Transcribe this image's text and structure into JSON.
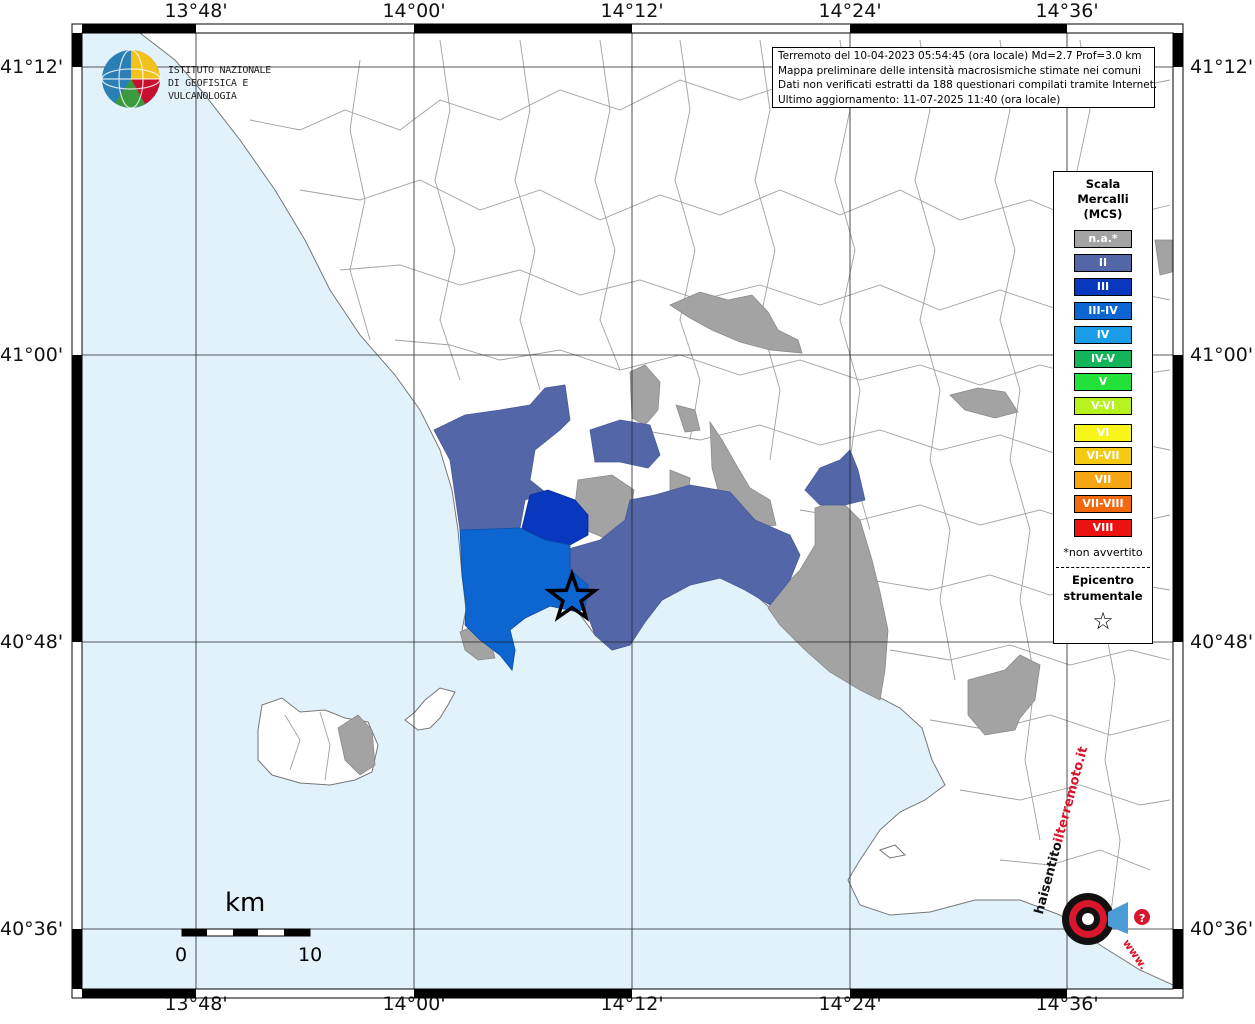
{
  "map": {
    "lon_ticks": [
      "13°48'",
      "14°00'",
      "14°12'",
      "14°24'",
      "14°36'"
    ],
    "lat_ticks": [
      "41°12'",
      "41°00'",
      "40°48'",
      "40°36'"
    ],
    "colors": {
      "sea": "#e2f2fb",
      "land": "#ffffff",
      "boundary": "#9a9a9a",
      "na": "#a3a3a3",
      "II": "#5266a8",
      "III": "#0838bd",
      "IIIIV": "#0c65d1"
    }
  },
  "info": {
    "line1": "Terremoto del 10-04-2023 05:54:45 (ora locale) Md=2.7 Prof=3.0 km",
    "line2": "Mappa preliminare delle intensità macrosismiche stimate nei comuni",
    "line3": "Dati non verificati estratti da 188 questionari compilati tramite Internet.",
    "line4": "Ultimo aggiornamento: 11-07-2025 11:40 (ora locale)"
  },
  "logo": {
    "line1": "ISTITUTO NAZIONALE",
    "line2": "DI GEOFISICA E VULCANOLOGIA"
  },
  "legend": {
    "title1": "Scala",
    "title2": "Mercalli",
    "title3": "(MCS)",
    "items": [
      {
        "label": "n.a.*",
        "color": "#a3a3a3"
      },
      {
        "label": "II",
        "color": "#5266a8"
      },
      {
        "label": "III",
        "color": "#0838bd"
      },
      {
        "label": "III-IV",
        "color": "#0c65d1"
      },
      {
        "label": "IV",
        "color": "#1a9ce6"
      },
      {
        "label": "IV-V",
        "color": "#14b45a"
      },
      {
        "label": "V",
        "color": "#22e23a"
      },
      {
        "label": "V-VI",
        "color": "#b6f21e"
      },
      {
        "label": "VI",
        "color": "#f8f51a"
      },
      {
        "label": "VI-VII",
        "color": "#f6ca12"
      },
      {
        "label": "VII",
        "color": "#f6a612"
      },
      {
        "label": "VII-VIII",
        "color": "#f2690f"
      },
      {
        "label": "VIII",
        "color": "#ec1212"
      }
    ],
    "note": "*non avvertito",
    "epi1": "Epicentro",
    "epi2": "strumentale",
    "star": "☆"
  },
  "scale": {
    "unit": "km",
    "min": "0",
    "max": "10"
  },
  "brand": {
    "text1": "haisentito",
    "text2": "ilterremoto.it",
    "text3": "www."
  }
}
